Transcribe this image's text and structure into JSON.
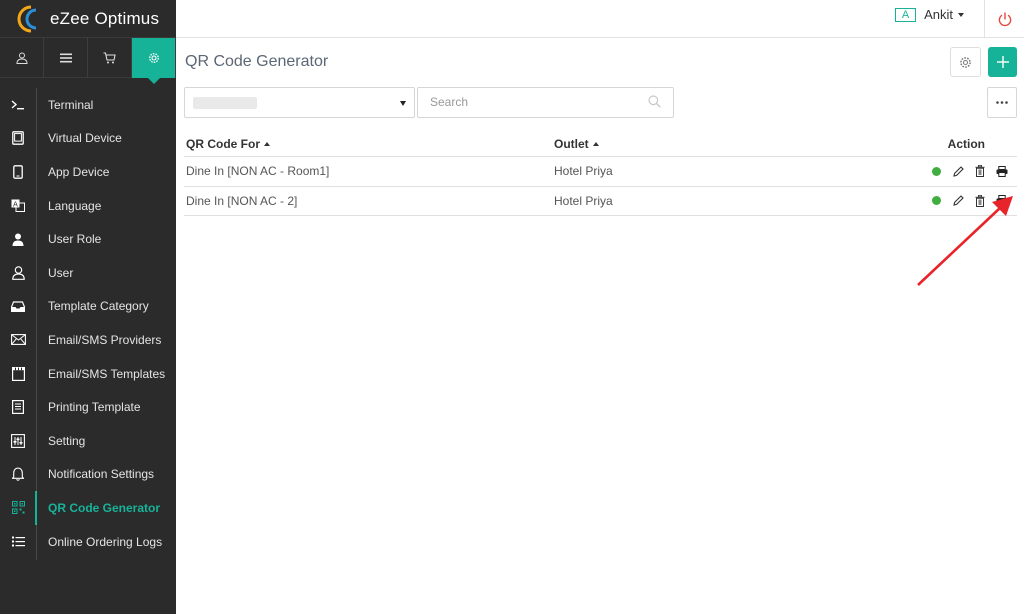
{
  "app": {
    "name": "eZee Optimus"
  },
  "user": {
    "badge": "A",
    "name": "Ankit"
  },
  "top_tabs": [
    {
      "icon": "user-icon"
    },
    {
      "icon": "menu-icon"
    },
    {
      "icon": "cart-icon"
    },
    {
      "icon": "gear-icon",
      "active": true
    }
  ],
  "sidebar": {
    "items": [
      {
        "label": "Terminal",
        "icon": "terminal-icon"
      },
      {
        "label": "Virtual Device",
        "icon": "tablet-icon"
      },
      {
        "label": "App Device",
        "icon": "mobile-icon"
      },
      {
        "label": "Language",
        "icon": "language-icon"
      },
      {
        "label": "User Role",
        "icon": "user-role-icon"
      },
      {
        "label": "User",
        "icon": "user-icon"
      },
      {
        "label": "Template Category",
        "icon": "inbox-icon"
      },
      {
        "label": "Email/SMS Providers",
        "icon": "envelope-icon"
      },
      {
        "label": "Email/SMS Templates",
        "icon": "template-icon"
      },
      {
        "label": "Printing Template",
        "icon": "document-icon"
      },
      {
        "label": "Setting",
        "icon": "sliders-icon"
      },
      {
        "label": "Notification Settings",
        "icon": "bell-icon"
      },
      {
        "label": "QR Code Generator",
        "icon": "qr-code-icon",
        "active": true
      },
      {
        "label": "Online Ordering Logs",
        "icon": "list-icon"
      }
    ]
  },
  "page": {
    "title": "QR Code Generator"
  },
  "search": {
    "placeholder": "Search"
  },
  "table": {
    "columns": [
      "QR Code For",
      "Outlet",
      "Action"
    ],
    "rows": [
      {
        "qr_for": "Dine In [NON AC - Room1]",
        "outlet": "Hotel Priya",
        "status": "active"
      },
      {
        "qr_for": "Dine In [NON AC - 2]",
        "outlet": "Hotel Priya",
        "status": "active"
      }
    ]
  },
  "colors": {
    "accent": "#17b399",
    "sidebar_bg": "#2b2b2b",
    "status_active": "#3fae3f",
    "arrow": "#e8242b"
  }
}
